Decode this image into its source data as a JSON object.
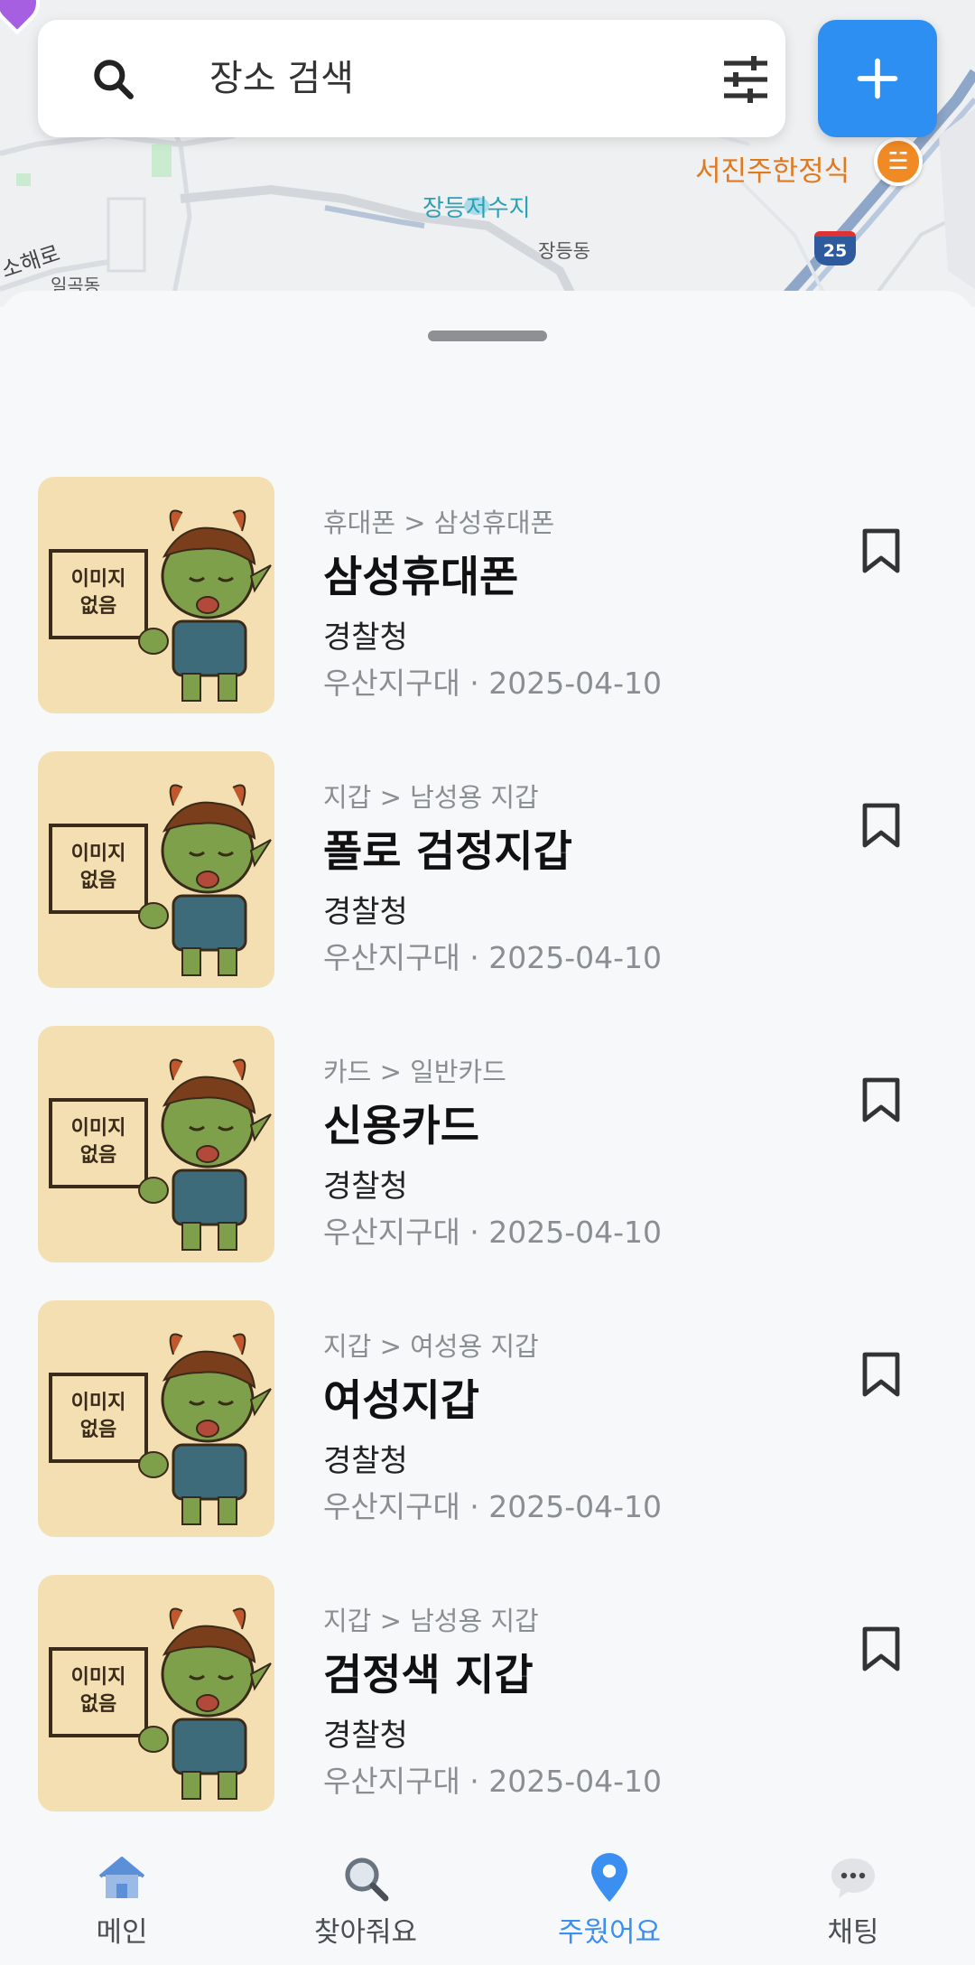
{
  "search": {
    "placeholder": "장소 검색"
  },
  "map": {
    "labels": {
      "water": "장등저수지",
      "dong1": "장등동",
      "dong2": "일곡동",
      "road": "소해로",
      "restaurant": "서진주한정식"
    },
    "highway_number": "25"
  },
  "items": [
    {
      "category": "휴대폰 > 삼성휴대폰",
      "title": "삼성휴대폰",
      "org": "경찰청",
      "meta": "우산지구대 · 2025-04-10",
      "thumb_text": [
        "이미지",
        "없음"
      ]
    },
    {
      "category": "지갑 > 남성용 지갑",
      "title": "폴로 검정지갑",
      "org": "경찰청",
      "meta": "우산지구대 · 2025-04-10",
      "thumb_text": [
        "이미지",
        "없음"
      ]
    },
    {
      "category": "카드 > 일반카드",
      "title": "신용카드",
      "org": "경찰청",
      "meta": "우산지구대 · 2025-04-10",
      "thumb_text": [
        "이미지",
        "없음"
      ]
    },
    {
      "category": "지갑 > 여성용 지갑",
      "title": "여성지갑",
      "org": "경찰청",
      "meta": "우산지구대 · 2025-04-10",
      "thumb_text": [
        "이미지",
        "없음"
      ]
    },
    {
      "category": "지갑 > 남성용 지갑",
      "title": "검정색 지갑",
      "org": "경찰청",
      "meta": "우산지구대 · 2025-04-10",
      "thumb_text": [
        "이미지",
        "없음"
      ]
    }
  ],
  "nav": [
    {
      "label": "메인",
      "icon": "home-icon",
      "active": false
    },
    {
      "label": "찾아줘요",
      "icon": "search-icon",
      "active": false
    },
    {
      "label": "주웠어요",
      "icon": "location-pin-icon",
      "active": true
    },
    {
      "label": "채팅",
      "icon": "chat-bubble-icon",
      "active": false
    }
  ],
  "colors": {
    "accent": "#2e8ff3",
    "nav_active": "#3a8ff0",
    "thumb_bg": "#f4dfb2",
    "restaurant": "#e07a1f"
  }
}
